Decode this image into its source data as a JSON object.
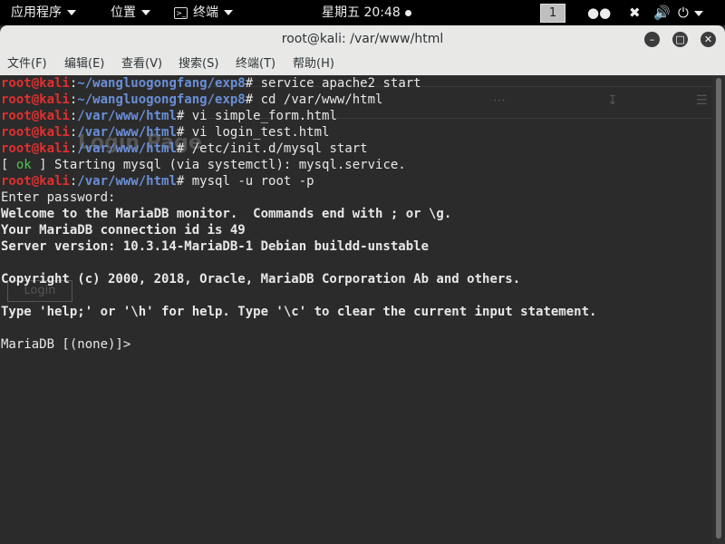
{
  "topbar": {
    "apps": "应用程序",
    "places": "位置",
    "terminal_icon": "terminal-icon",
    "terminal": "终端",
    "clock": "星期五 20:48",
    "workspace": "1"
  },
  "window": {
    "title": "root@kali: /var/www/html"
  },
  "menu": [
    "文件(F)",
    "编辑(E)",
    "查看(V)",
    "搜索(S)",
    "终端(T)",
    "帮助(H)"
  ],
  "ghost": {
    "heading": "Login Page",
    "button": "Login"
  },
  "terminal": {
    "lines": [
      {
        "type": "prompt",
        "user": "root@kali",
        "path": "~/wangluogongfang/exp8",
        "cmd": " service apache2 start"
      },
      {
        "type": "prompt",
        "user": "root@kali",
        "path": "~/wangluogongfang/exp8",
        "cmd": " cd /var/www/html"
      },
      {
        "type": "prompt",
        "user": "root@kali",
        "path": "/var/www/html",
        "cmd": " vi simple_form.html"
      },
      {
        "type": "prompt",
        "user": "root@kali",
        "path": "/var/www/html",
        "cmd": " vi login_test.html"
      },
      {
        "type": "prompt",
        "user": "root@kali",
        "path": "/var/www/html",
        "cmd": " /etc/init.d/mysql start"
      },
      {
        "type": "status",
        "ok": "ok",
        "text": "Starting mysql (via systemctl): mysql.service."
      },
      {
        "type": "prompt",
        "user": "root@kali",
        "path": "/var/www/html",
        "cmd": " mysql -u root -p"
      },
      {
        "type": "text",
        "text": "Enter password:"
      },
      {
        "type": "bold",
        "text": "Welcome to the MariaDB monitor.  Commands end with ; or \\g."
      },
      {
        "type": "bold",
        "text": "Your MariaDB connection id is 49"
      },
      {
        "type": "bold",
        "text": "Server version: 10.3.14-MariaDB-1 Debian buildd-unstable"
      },
      {
        "type": "text",
        "text": ""
      },
      {
        "type": "bold",
        "text": "Copyright (c) 2000, 2018, Oracle, MariaDB Corporation Ab and others."
      },
      {
        "type": "text",
        "text": ""
      },
      {
        "type": "bold",
        "text": "Type 'help;' or '\\h' for help. Type '\\c' to clear the current input statement."
      },
      {
        "type": "text",
        "text": ""
      },
      {
        "type": "text",
        "text": "MariaDB [(none)]>"
      }
    ]
  }
}
